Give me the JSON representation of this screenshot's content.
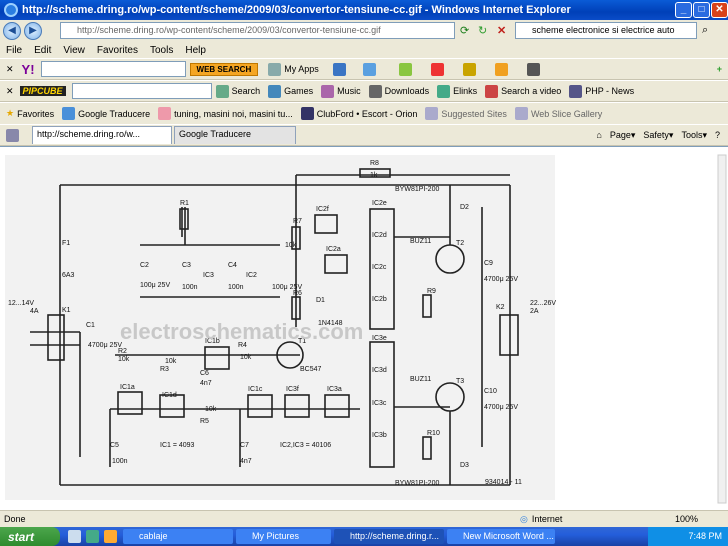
{
  "window": {
    "title": "http://scheme.dring.ro/wp-content/scheme/2009/03/convertor-tensiune-cc.gif - Windows Internet Explorer"
  },
  "address": {
    "url": "http://scheme.dring.ro/wp-content/scheme/2009/03/convertor-tensiune-cc.gif",
    "search": "scheme electronice si electrice auto"
  },
  "menu": [
    "File",
    "Edit",
    "View",
    "Favorites",
    "Tools",
    "Help"
  ],
  "yahoo": {
    "web_search": "WEB SEARCH",
    "myapps": "My Apps"
  },
  "pipcube": {
    "logo": "PIPCUBE",
    "search": "Search",
    "games": "Games",
    "music": "Music",
    "downloads": "Downloads",
    "elinks": "Elinks",
    "searchvideo": "Search a video",
    "php": "PHP - News"
  },
  "favbar": {
    "favorites": "Favorites",
    "items": [
      "Google Traducere",
      "tuning, masini noi, masini tu...",
      "ClubFord • Escort - Orion",
      "Suggested Sites",
      "Web Slice Gallery"
    ]
  },
  "tabs": [
    "http://scheme.dring.ro/w...",
    "Google Traducere"
  ],
  "cmd": {
    "page": "Page",
    "safety": "Safety",
    "tools": "Tools"
  },
  "status": {
    "left": "Done",
    "zone": "Internet",
    "zoom": "100%"
  },
  "taskbar": {
    "start": "start",
    "items": [
      "cablaje",
      "My Pictures",
      "http://scheme.dring.r...",
      "New Microsoft Word ..."
    ],
    "time": "7:48 PM"
  },
  "schematic": {
    "k1": "K1",
    "k1v": "12...14V",
    "k1a": "4A",
    "k2": "K2",
    "k2v": "22...26V",
    "k2a": "2A",
    "f1": "F1",
    "f1v": "6A3",
    "c1": "C1",
    "c1v": "4700μ 25V",
    "r1": "R1",
    "r2": "R2",
    "r2v": "10k",
    "r3": "R3",
    "r3v": "10k",
    "r4": "R4",
    "r4v": "10k",
    "r5": "R5",
    "r5v": "10k",
    "r6": "R6",
    "r7": "R7",
    "r7v": "10k",
    "r8": "R8",
    "r8v": "1k",
    "r9": "R9",
    "r10": "R10",
    "c2": "C2",
    "c2v": "100μ 25V",
    "c3": "C3",
    "c3v": "100n",
    "c4": "C4",
    "c4v": "100n",
    "c5": "C5",
    "c5v": "100n",
    "c6": "C6",
    "c6v": "4n7",
    "c7": "C7",
    "c7v": "4n7",
    "c9": "C9",
    "c9v": "4700μ 25V",
    "c10": "C10",
    "c10v": "4700μ 25V",
    "ic1": "IC1",
    "ic2": "IC2",
    "ic3": "IC3",
    "d1": "D1",
    "d1v": "1N4148",
    "d2": "D2",
    "d3": "D3",
    "t1": "T1",
    "t1v": "BC547",
    "t2": "T2",
    "t3": "T3",
    "buz1": "BUZ11",
    "buz2": "BUZ11",
    "byw1": "BYW81PI-200",
    "byw2": "BYW81PI-200",
    "note1": "IC1 = 4093",
    "note2": "IC2,IC3 = 40106",
    "ref": "934014 - 11",
    "gates": [
      "IC2f",
      "IC2a",
      "IC2e",
      "IC2d",
      "IC2c",
      "IC2b",
      "IC3e",
      "IC3d",
      "IC3c",
      "IC3b",
      "IC1a",
      "IC1b",
      "IC1c",
      "IC1d",
      "IC3f",
      "IC3a"
    ],
    "watermark": "electroschematics.com"
  }
}
